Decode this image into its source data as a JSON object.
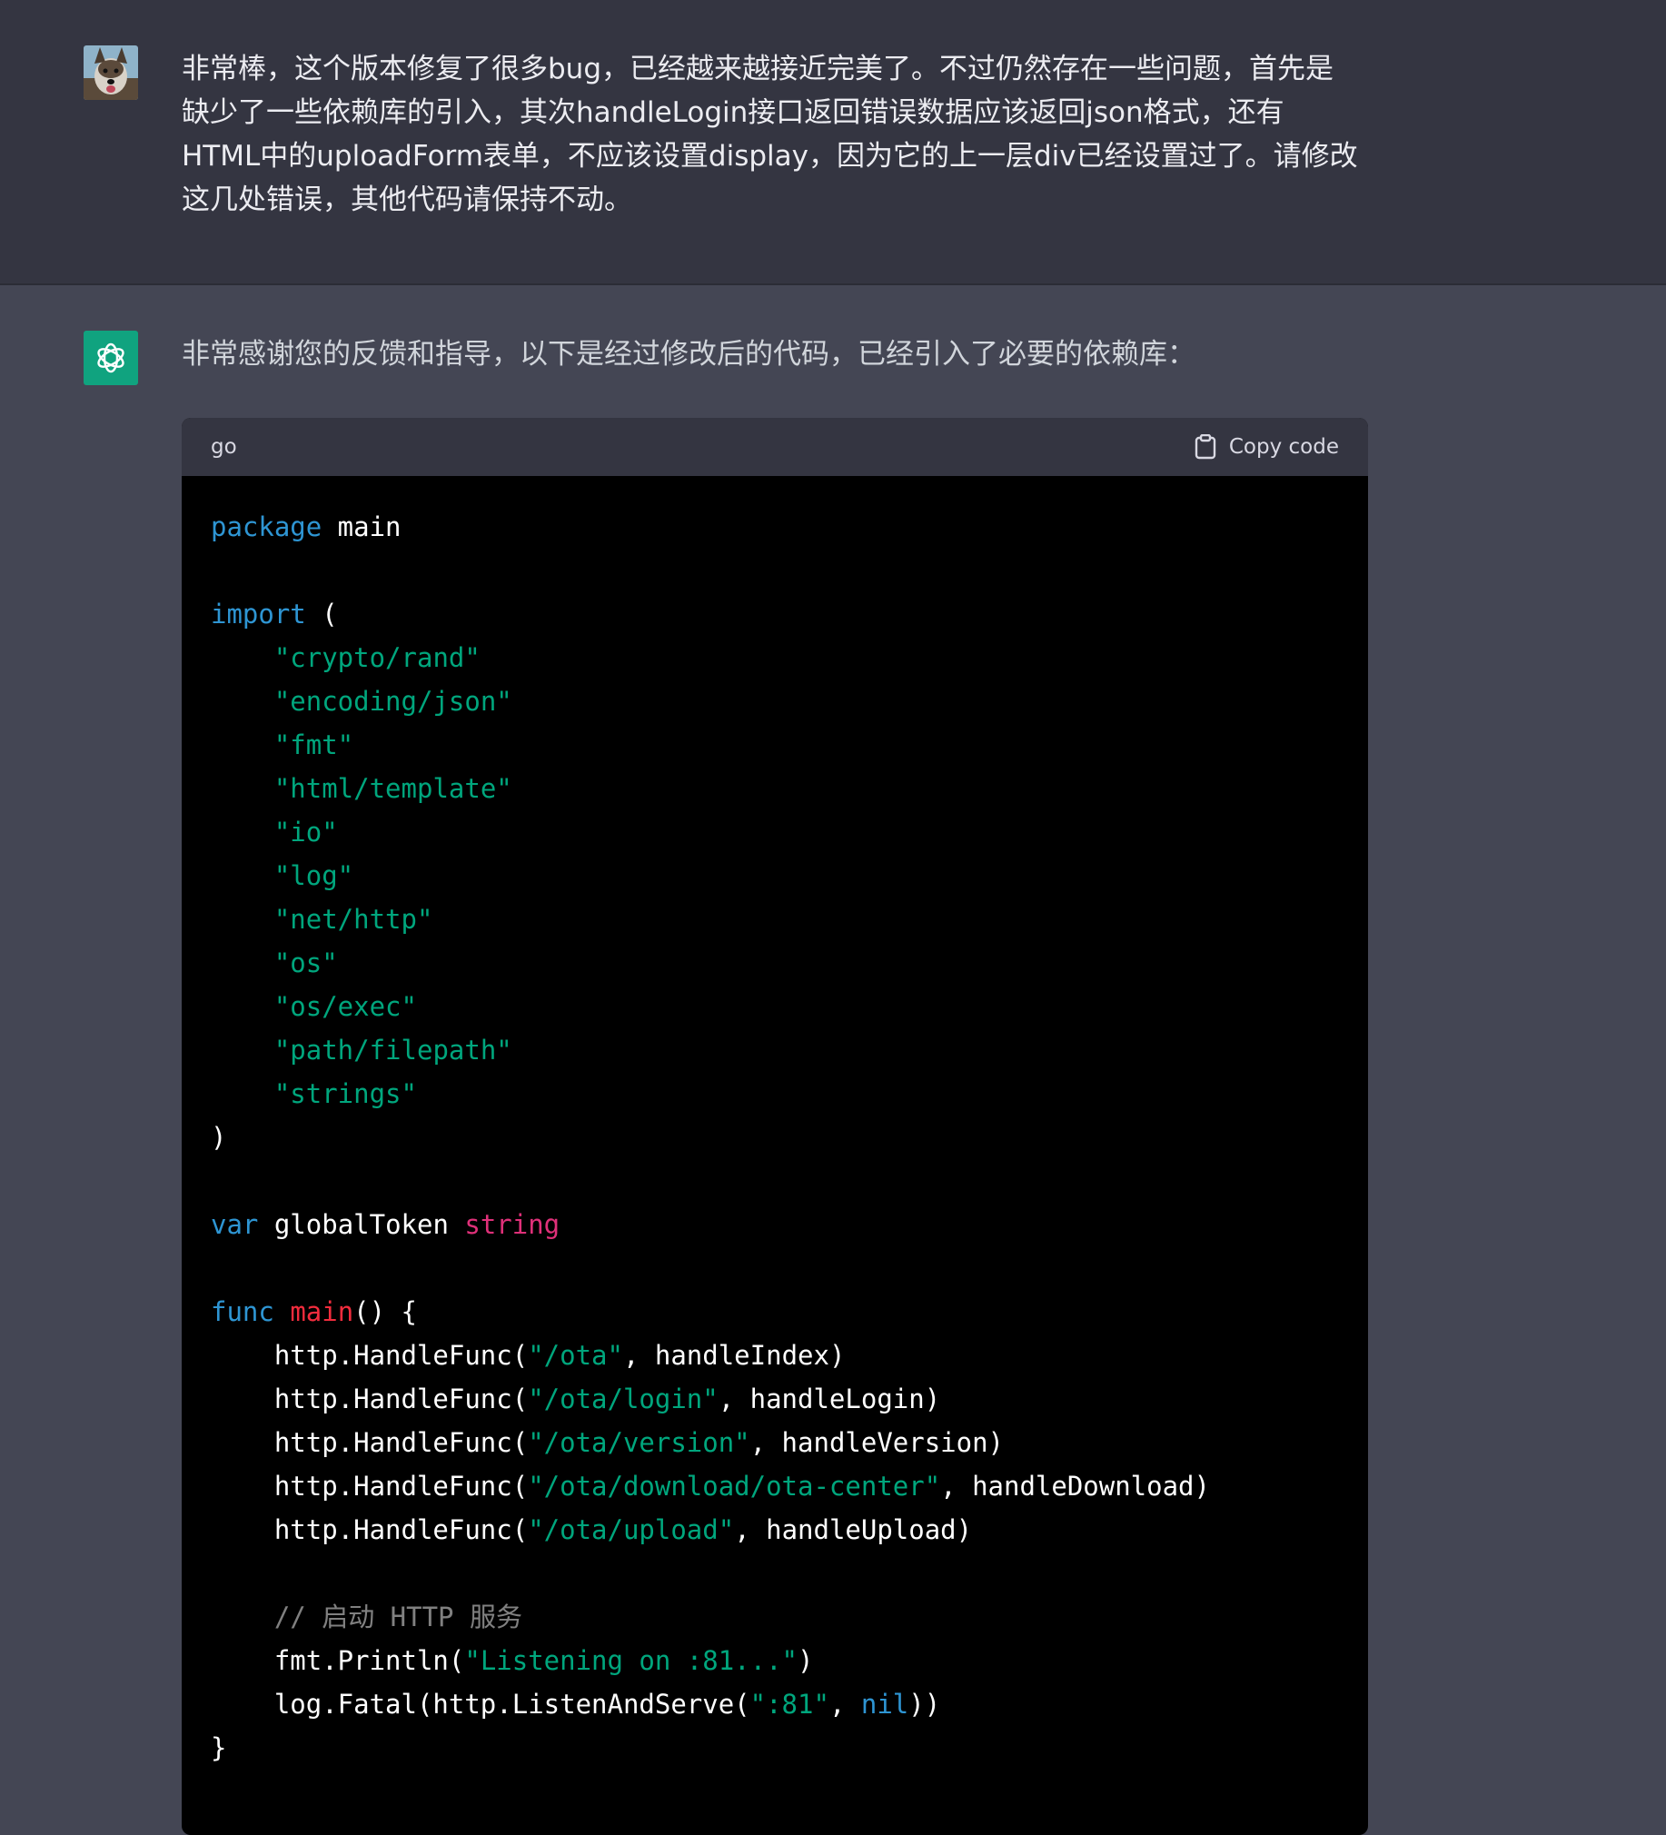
{
  "user_message": {
    "lines": [
      "非常棒，这个版本修复了很多bug，已经越来越接近完美了。不过仍然存在一些问题，首先是",
      "缺少了一些依赖库的引入，其次handleLogin接口返回错误数据应该返回json格式，还有",
      "HTML中的uploadForm表单，不应该设置display，因为它的上一层div已经设置过了。请修改",
      "这几处错误，其他代码请保持不动。"
    ]
  },
  "assistant_message": {
    "intro": "非常感谢您的反馈和指导，以下是经过修改后的代码，已经引入了必要的依赖库：",
    "code_block": {
      "language": "go",
      "copy_label": "Copy code",
      "lines": [
        [
          {
            "t": "package",
            "c": "kw"
          },
          {
            "t": " main",
            "c": ""
          }
        ],
        [],
        [
          {
            "t": "import",
            "c": "kw"
          },
          {
            "t": " (",
            "c": ""
          }
        ],
        [
          {
            "t": "    ",
            "c": ""
          },
          {
            "t": "\"crypto/rand\"",
            "c": "str"
          }
        ],
        [
          {
            "t": "    ",
            "c": ""
          },
          {
            "t": "\"encoding/json\"",
            "c": "str"
          }
        ],
        [
          {
            "t": "    ",
            "c": ""
          },
          {
            "t": "\"fmt\"",
            "c": "str"
          }
        ],
        [
          {
            "t": "    ",
            "c": ""
          },
          {
            "t": "\"html/template\"",
            "c": "str"
          }
        ],
        [
          {
            "t": "    ",
            "c": ""
          },
          {
            "t": "\"io\"",
            "c": "str"
          }
        ],
        [
          {
            "t": "    ",
            "c": ""
          },
          {
            "t": "\"log\"",
            "c": "str"
          }
        ],
        [
          {
            "t": "    ",
            "c": ""
          },
          {
            "t": "\"net/http\"",
            "c": "str"
          }
        ],
        [
          {
            "t": "    ",
            "c": ""
          },
          {
            "t": "\"os\"",
            "c": "str"
          }
        ],
        [
          {
            "t": "    ",
            "c": ""
          },
          {
            "t": "\"os/exec\"",
            "c": "str"
          }
        ],
        [
          {
            "t": "    ",
            "c": ""
          },
          {
            "t": "\"path/filepath\"",
            "c": "str"
          }
        ],
        [
          {
            "t": "    ",
            "c": ""
          },
          {
            "t": "\"strings\"",
            "c": "str"
          }
        ],
        [
          {
            "t": ")",
            "c": ""
          }
        ],
        [],
        [
          {
            "t": "var",
            "c": "kw"
          },
          {
            "t": " globalToken ",
            "c": ""
          },
          {
            "t": "string",
            "c": "type"
          }
        ],
        [],
        [
          {
            "t": "func",
            "c": "kw"
          },
          {
            "t": " ",
            "c": ""
          },
          {
            "t": "main",
            "c": "fn"
          },
          {
            "t": "() {",
            "c": ""
          }
        ],
        [
          {
            "t": "    http.HandleFunc(",
            "c": ""
          },
          {
            "t": "\"/ota\"",
            "c": "str"
          },
          {
            "t": ", handleIndex)",
            "c": ""
          }
        ],
        [
          {
            "t": "    http.HandleFunc(",
            "c": ""
          },
          {
            "t": "\"/ota/login\"",
            "c": "str"
          },
          {
            "t": ", handleLogin)",
            "c": ""
          }
        ],
        [
          {
            "t": "    http.HandleFunc(",
            "c": ""
          },
          {
            "t": "\"/ota/version\"",
            "c": "str"
          },
          {
            "t": ", handleVersion)",
            "c": ""
          }
        ],
        [
          {
            "t": "    http.HandleFunc(",
            "c": ""
          },
          {
            "t": "\"/ota/download/ota-center\"",
            "c": "str"
          },
          {
            "t": ", handleDownload)",
            "c": ""
          }
        ],
        [
          {
            "t": "    http.HandleFunc(",
            "c": ""
          },
          {
            "t": "\"/ota/upload\"",
            "c": "str"
          },
          {
            "t": ", handleUpload)",
            "c": ""
          }
        ],
        [],
        [
          {
            "t": "    ",
            "c": ""
          },
          {
            "t": "// 启动 HTTP 服务",
            "c": "cm"
          }
        ],
        [
          {
            "t": "    fmt.Println(",
            "c": ""
          },
          {
            "t": "\"Listening on :81...\"",
            "c": "str"
          },
          {
            "t": ")",
            "c": ""
          }
        ],
        [
          {
            "t": "    log.Fatal(http.ListenAndServe(",
            "c": ""
          },
          {
            "t": "\":81\"",
            "c": "str"
          },
          {
            "t": ", ",
            "c": ""
          },
          {
            "t": "nil",
            "c": "kw"
          },
          {
            "t": "))",
            "c": ""
          }
        ],
        [
          {
            "t": "}",
            "c": ""
          }
        ]
      ]
    }
  },
  "colors": {
    "user_bg": "#343541",
    "assistant_bg": "#444654",
    "code_bg": "#000000",
    "keyword": "#2e95d3",
    "string": "#00a67d",
    "type": "#df3079",
    "function": "#f22c3d",
    "gpt_avatar": "#10a37f"
  }
}
